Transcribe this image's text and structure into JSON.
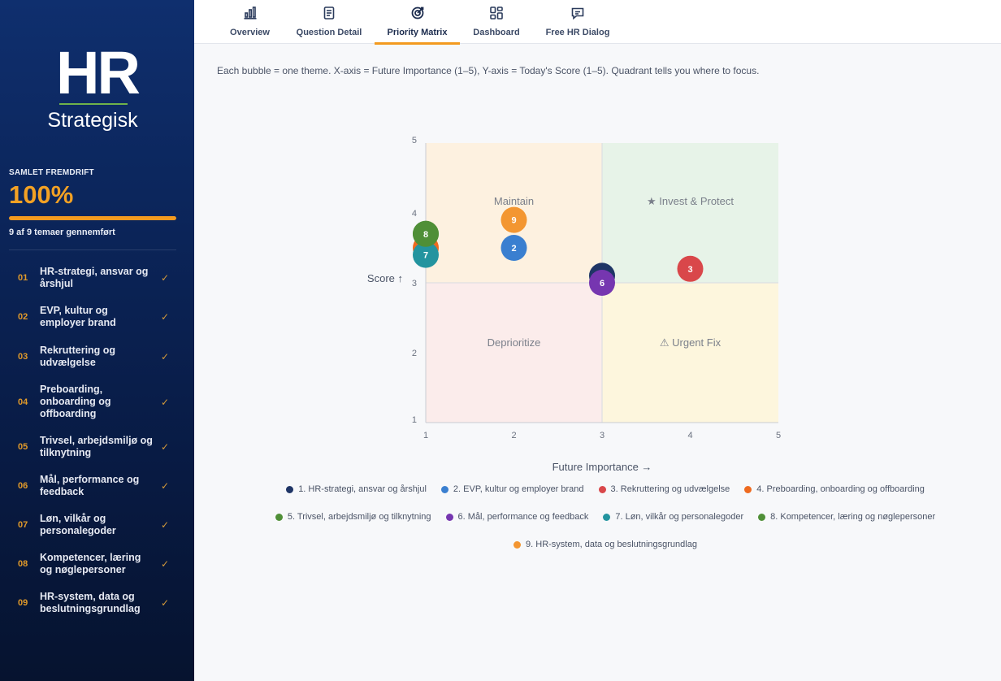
{
  "sidebar": {
    "logo_main": "HR",
    "logo_sub": "Strategisk",
    "progress_label": "SAMLET FREMDRIFT",
    "progress_value": "100%",
    "progress_fraction": 1.0,
    "progress_sub": "9 af 9 temaer gennemført",
    "items": [
      {
        "num": "01",
        "label": "HR-strategi, ansvar og årshjul",
        "check": "✓"
      },
      {
        "num": "02",
        "label": "EVP, kultur og employer brand",
        "check": "✓"
      },
      {
        "num": "03",
        "label": "Rekruttering og udvælgelse",
        "check": "✓"
      },
      {
        "num": "04",
        "label": "Preboarding, onboarding og offboarding",
        "check": "✓"
      },
      {
        "num": "05",
        "label": "Trivsel, arbejdsmiljø og tilknytning",
        "check": "✓"
      },
      {
        "num": "06",
        "label": "Mål, performance og feedback",
        "check": "✓"
      },
      {
        "num": "07",
        "label": "Løn, vilkår og personalegoder",
        "check": "✓"
      },
      {
        "num": "08",
        "label": "Kompetencer, læring og nøglepersoner",
        "check": "✓"
      },
      {
        "num": "09",
        "label": "HR-system, data og beslutningsgrundlag",
        "check": "✓"
      }
    ]
  },
  "tabs": [
    {
      "label": "Overview",
      "icon": "bar-chart-icon"
    },
    {
      "label": "Question Detail",
      "icon": "document-icon"
    },
    {
      "label": "Priority Matrix",
      "icon": "target-icon",
      "active": true
    },
    {
      "label": "Dashboard",
      "icon": "grid-icon"
    },
    {
      "label": "Free HR Dialog",
      "icon": "chat-icon"
    }
  ],
  "description": "Each bubble = one theme. X-axis = Future Importance (1–5), Y-axis = Today's Score (1–5). Quadrant tells you where to focus.",
  "chart_data": {
    "type": "scatter",
    "xlabel": "Future Importance →",
    "ylabel": "Score ↑",
    "xlim": [
      1,
      5
    ],
    "ylim": [
      1,
      5
    ],
    "x_ticks": [
      "1",
      "2",
      "3",
      "4",
      "5"
    ],
    "y_ticks": [
      "1",
      "2",
      "3",
      "4",
      "5"
    ],
    "quadrants": [
      {
        "label": "Maintain",
        "color": "#fdf1e0"
      },
      {
        "label": "★ Invest & Protect",
        "color": "#e7f3e8"
      },
      {
        "label": "Deprioritize",
        "color": "#fbeceb"
      },
      {
        "label": "⚠ Urgent Fix",
        "color": "#fdf6dd"
      }
    ],
    "points": [
      {
        "id": "1",
        "x": 3.0,
        "y": 3.1,
        "color": "#1f3566"
      },
      {
        "id": "2",
        "x": 2.0,
        "y": 3.5,
        "color": "#3a7fd0"
      },
      {
        "id": "3",
        "x": 4.0,
        "y": 3.2,
        "color": "#d9474a"
      },
      {
        "id": "4",
        "x": 1.0,
        "y": 3.5,
        "color": "#ee6a1f"
      },
      {
        "id": "5",
        "x": 1.0,
        "y": 3.7,
        "color": "#4f8f37"
      },
      {
        "id": "6",
        "x": 3.0,
        "y": 3.0,
        "color": "#7636b0"
      },
      {
        "id": "7",
        "x": 1.0,
        "y": 3.4,
        "color": "#23949f"
      },
      {
        "id": "8",
        "x": 1.0,
        "y": 3.7,
        "color": "#4f8f37"
      },
      {
        "id": "9",
        "x": 2.0,
        "y": 3.9,
        "color": "#f39631"
      }
    ],
    "legend": [
      {
        "label": "1. HR-strategi, ansvar og årshjul",
        "color": "#1f3566"
      },
      {
        "label": "2. EVP, kultur og employer brand",
        "color": "#3a7fd0"
      },
      {
        "label": "3. Rekruttering og udvælgelse",
        "color": "#d9474a"
      },
      {
        "label": "4. Preboarding, onboarding og offboarding",
        "color": "#ee6a1f"
      },
      {
        "label": "5. Trivsel, arbejdsmiljø og tilknytning",
        "color": "#4f8f37"
      },
      {
        "label": "6. Mål, performance og feedback",
        "color": "#7636b0"
      },
      {
        "label": "7. Løn, vilkår og personalegoder",
        "color": "#23949f"
      },
      {
        "label": "8. Kompetencer, læring og nøglepersoner",
        "color": "#4f8f37"
      },
      {
        "label": "9. HR-system, data og beslutningsgrundlag",
        "color": "#f39631"
      }
    ]
  }
}
